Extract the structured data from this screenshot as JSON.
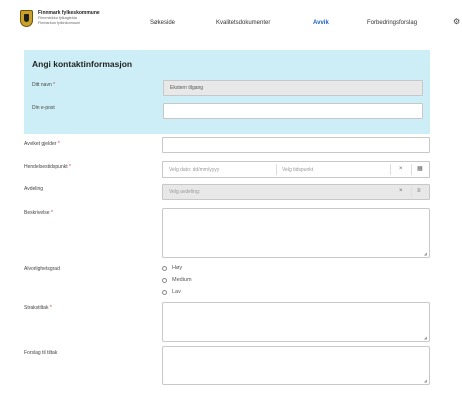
{
  "header": {
    "org_name": "Finnmark fylkeskommune",
    "org_sub1": "Finnmárkku fylkagielda",
    "org_sub2": "Finmarkun fylkinkomuuni",
    "nav": [
      "Søkeside",
      "Kvalitetsdokumenter",
      "Avvik",
      "Forbedringsforslag"
    ],
    "active_nav": "Avvik",
    "settings_icon": "gear-icon"
  },
  "contact": {
    "title": "Angi kontaktinformasjon",
    "name_label": "Ditt navn",
    "name_value": "Ekstern tilgang",
    "email_label": "Din e-post",
    "email_value": ""
  },
  "form": {
    "avvik_gjelder_label": "Avviket gjelder",
    "hendelse_label": "Hendelsestidspunkt",
    "date_placeholder": "Velg dato: dd/mm/yyyy",
    "time_placeholder": "Velg tidspunkt",
    "clear_symbol": "×",
    "avdeling_label": "Avdeling",
    "avdeling_placeholder": "Velg avdeling:",
    "beskrivelse_label": "Beskrivelse",
    "alvor_label": "Alvorlighetsgrad",
    "alvor_options": [
      "Høy",
      "Medium",
      "Lav"
    ],
    "strakstiltak_label": "Strakstiltak",
    "forslag_label": "Forslag til tiltak",
    "required_mark": "*"
  },
  "colors": {
    "contact_bg": "#cdeef7",
    "accent": "#1a5fc9",
    "required": "#d63030"
  }
}
